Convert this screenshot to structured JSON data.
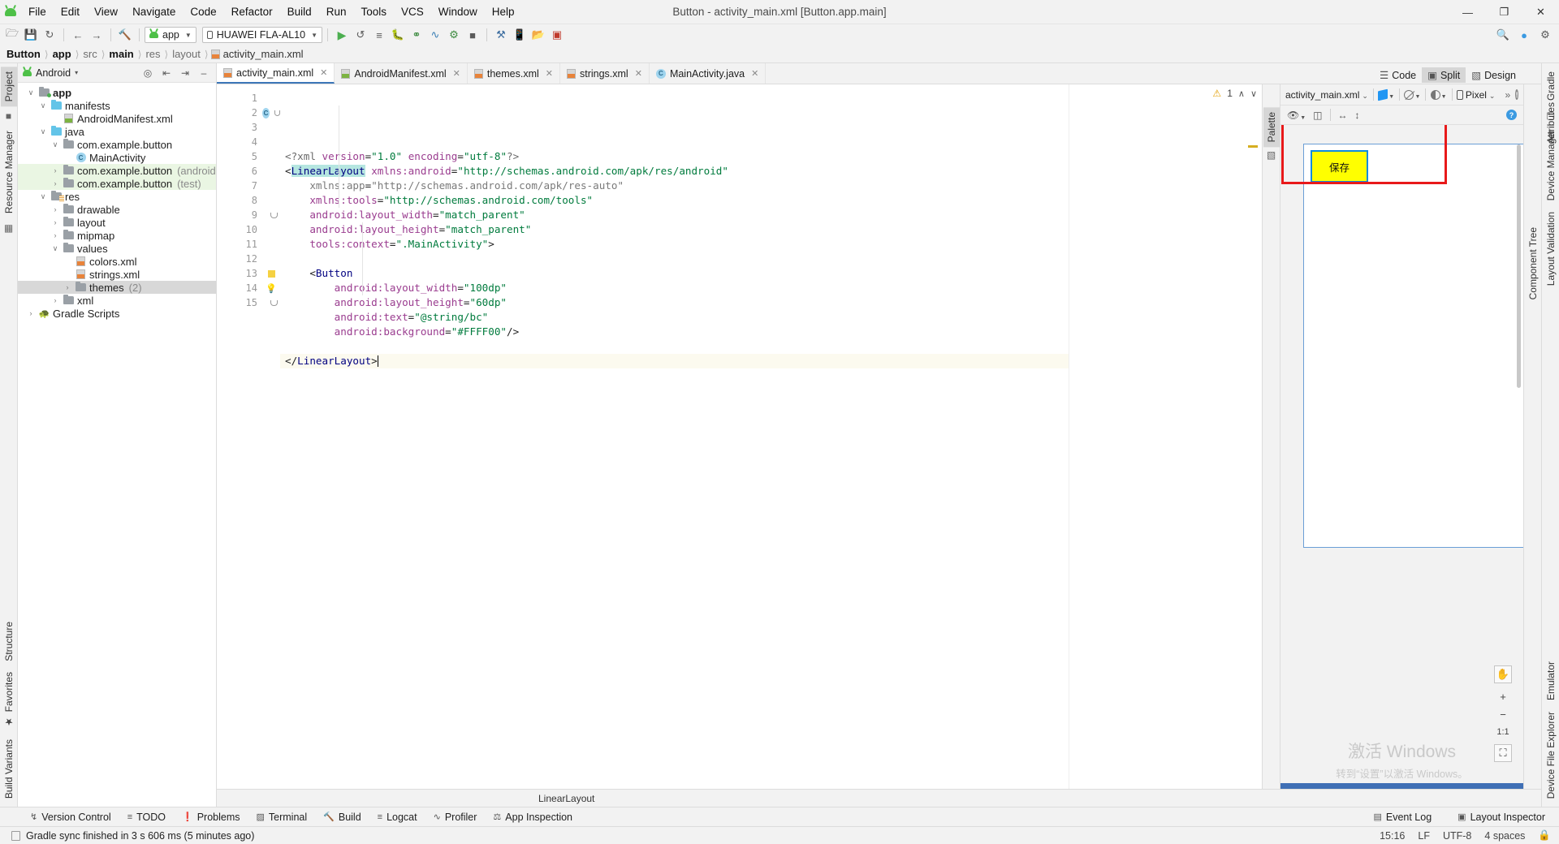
{
  "window": {
    "title": "Button - activity_main.xml [Button.app.main]",
    "minimize": "—",
    "maximize": "❐",
    "close": "✕"
  },
  "menubar": {
    "items": [
      "File",
      "Edit",
      "View",
      "Navigate",
      "Code",
      "Refactor",
      "Build",
      "Run",
      "Tools",
      "VCS",
      "Window",
      "Help"
    ]
  },
  "toolbar": {
    "module_selector": "app",
    "device_selector": "HUAWEI FLA-AL10",
    "icons": [
      "open-folder-icon",
      "save-icon",
      "sync-icon",
      "back-icon",
      "forward-icon",
      "build-hammer-icon",
      "run-icon",
      "run-coverage-icon",
      "run-with-profiler-icon",
      "debug-icon",
      "attach-debugger-icon",
      "profiler-icon",
      "run-device-icon",
      "stop-icon",
      "sdk-manager-icon",
      "avd-manager-icon",
      "device-file-explorer-icon",
      "layout-inspector-icon"
    ],
    "right_icons": [
      "search-icon",
      "account-icon",
      "settings-icon"
    ]
  },
  "breadcrumb": {
    "items": [
      {
        "label": "Button",
        "bold": true
      },
      {
        "label": "app",
        "bold": true
      },
      {
        "label": "src",
        "bold": false
      },
      {
        "label": "main",
        "bold": true
      },
      {
        "label": "res",
        "bold": false
      },
      {
        "label": "layout",
        "bold": false
      }
    ],
    "file": "activity_main.xml"
  },
  "left_rail": {
    "top_tabs": [
      "Project",
      "Resource Manager"
    ],
    "bottom_tabs": [
      "Structure",
      "Favorites",
      "Build Variants"
    ]
  },
  "project_panel": {
    "header": {
      "title": "Android",
      "caret": "▾",
      "icons": [
        "locate-icon",
        "expand-all-icon",
        "collapse-all-icon",
        "hide-icon"
      ]
    },
    "tree": [
      {
        "depth": 0,
        "twist": "∨",
        "icon": "folder-green-dot",
        "label": "app",
        "bold": true,
        "dim": "",
        "hl": ""
      },
      {
        "depth": 1,
        "twist": "∨",
        "icon": "folder-blue",
        "label": "manifests",
        "bold": false,
        "dim": "",
        "hl": ""
      },
      {
        "depth": 2,
        "twist": "",
        "icon": "file-manifest",
        "label": "AndroidManifest.xml",
        "bold": false,
        "dim": "",
        "hl": ""
      },
      {
        "depth": 1,
        "twist": "∨",
        "icon": "folder-blue",
        "label": "java",
        "bold": false,
        "dim": "",
        "hl": ""
      },
      {
        "depth": 2,
        "twist": "∨",
        "icon": "folder-pkg",
        "label": "com.example.button",
        "bold": false,
        "dim": "",
        "hl": ""
      },
      {
        "depth": 3,
        "twist": "",
        "icon": "class-icon",
        "label": "MainActivity",
        "bold": false,
        "dim": "",
        "hl": ""
      },
      {
        "depth": 2,
        "twist": "›",
        "icon": "folder-pkg",
        "label": "com.example.button",
        "bold": false,
        "dim": "(androidTest)",
        "hl": "green"
      },
      {
        "depth": 2,
        "twist": "›",
        "icon": "folder-pkg",
        "label": "com.example.button",
        "bold": false,
        "dim": "(test)",
        "hl": "green"
      },
      {
        "depth": 1,
        "twist": "∨",
        "icon": "folder-res",
        "label": "res",
        "bold": false,
        "dim": "",
        "hl": ""
      },
      {
        "depth": 2,
        "twist": "›",
        "icon": "folder-pkg",
        "label": "drawable",
        "bold": false,
        "dim": "",
        "hl": ""
      },
      {
        "depth": 2,
        "twist": "›",
        "icon": "folder-pkg",
        "label": "layout",
        "bold": false,
        "dim": "",
        "hl": ""
      },
      {
        "depth": 2,
        "twist": "›",
        "icon": "folder-pkg",
        "label": "mipmap",
        "bold": false,
        "dim": "",
        "hl": ""
      },
      {
        "depth": 2,
        "twist": "∨",
        "icon": "folder-pkg",
        "label": "values",
        "bold": false,
        "dim": "",
        "hl": ""
      },
      {
        "depth": 3,
        "twist": "",
        "icon": "file-xml",
        "label": "colors.xml",
        "bold": false,
        "dim": "",
        "hl": ""
      },
      {
        "depth": 3,
        "twist": "",
        "icon": "file-xml",
        "label": "strings.xml",
        "bold": false,
        "dim": "",
        "hl": ""
      },
      {
        "depth": 3,
        "twist": "›",
        "icon": "folder-pkg",
        "label": "themes",
        "bold": false,
        "dim": "(2)",
        "hl": "grey"
      },
      {
        "depth": 2,
        "twist": "›",
        "icon": "folder-pkg",
        "label": "xml",
        "bold": false,
        "dim": "",
        "hl": ""
      },
      {
        "depth": 0,
        "twist": "›",
        "icon": "gradle-icon",
        "label": "Gradle Scripts",
        "bold": false,
        "dim": "",
        "hl": ""
      }
    ]
  },
  "editor_tabs": [
    {
      "label": "activity_main.xml",
      "icon": "xml-file-icon",
      "active": true
    },
    {
      "label": "AndroidManifest.xml",
      "icon": "manifest-file-icon",
      "active": false
    },
    {
      "label": "themes.xml",
      "icon": "xml-file-icon",
      "active": false
    },
    {
      "label": "strings.xml",
      "icon": "xml-file-icon",
      "active": false
    },
    {
      "label": "MainActivity.java",
      "icon": "java-class-icon",
      "active": false
    }
  ],
  "code": {
    "lines": [
      {
        "n": 1,
        "current": false,
        "tokens": [
          {
            "t": "<?xml ",
            "c": "tk-pi"
          },
          {
            "t": "version",
            "c": "tk-attr"
          },
          {
            "t": "=",
            "c": "tk-punc"
          },
          {
            "t": "\"1.0\"",
            "c": "tk-val"
          },
          {
            "t": " ",
            "c": "tk-punc"
          },
          {
            "t": "encoding",
            "c": "tk-attr"
          },
          {
            "t": "=",
            "c": "tk-punc"
          },
          {
            "t": "\"utf-8\"",
            "c": "tk-val"
          },
          {
            "t": "?>",
            "c": "tk-pi"
          }
        ]
      },
      {
        "n": 2,
        "current": false,
        "tokens": [
          {
            "t": "<",
            "c": "tk-punc"
          },
          {
            "t": "LinearLayout",
            "c": "tk-tag-hl"
          },
          {
            "t": " ",
            "c": "tk-punc"
          },
          {
            "t": "xmlns:android",
            "c": "tk-attr"
          },
          {
            "t": "=",
            "c": "tk-punc"
          },
          {
            "t": "\"http://schemas.android.com/apk/res/android\"",
            "c": "tk-val"
          }
        ]
      },
      {
        "n": 3,
        "current": false,
        "tokens": [
          {
            "t": "    ",
            "c": "tk-punc"
          },
          {
            "t": "xmlns:app",
            "c": "tk-grey"
          },
          {
            "t": "=",
            "c": "tk-punc"
          },
          {
            "t": "\"http://schemas.android.com/apk/res-auto\"",
            "c": "tk-grey"
          }
        ]
      },
      {
        "n": 4,
        "current": false,
        "tokens": [
          {
            "t": "    ",
            "c": "tk-punc"
          },
          {
            "t": "xmlns:tools",
            "c": "tk-attr"
          },
          {
            "t": "=",
            "c": "tk-punc"
          },
          {
            "t": "\"http://schemas.android.com/tools\"",
            "c": "tk-val"
          }
        ]
      },
      {
        "n": 5,
        "current": false,
        "tokens": [
          {
            "t": "    ",
            "c": "tk-punc"
          },
          {
            "t": "android:layout_width",
            "c": "tk-attr"
          },
          {
            "t": "=",
            "c": "tk-punc"
          },
          {
            "t": "\"match_parent\"",
            "c": "tk-val"
          }
        ]
      },
      {
        "n": 6,
        "current": false,
        "tokens": [
          {
            "t": "    ",
            "c": "tk-punc"
          },
          {
            "t": "android:layout_height",
            "c": "tk-attr"
          },
          {
            "t": "=",
            "c": "tk-punc"
          },
          {
            "t": "\"match_parent\"",
            "c": "tk-val"
          }
        ]
      },
      {
        "n": 7,
        "current": false,
        "tokens": [
          {
            "t": "    ",
            "c": "tk-punc"
          },
          {
            "t": "tools:context",
            "c": "tk-attr"
          },
          {
            "t": "=",
            "c": "tk-punc"
          },
          {
            "t": "\".MainActivity\"",
            "c": "tk-val"
          },
          {
            "t": ">",
            "c": "tk-punc"
          }
        ]
      },
      {
        "n": 8,
        "current": false,
        "tokens": []
      },
      {
        "n": 9,
        "current": false,
        "tokens": [
          {
            "t": "    <",
            "c": "tk-punc"
          },
          {
            "t": "Button",
            "c": "tk-tag"
          }
        ]
      },
      {
        "n": 10,
        "current": false,
        "tokens": [
          {
            "t": "        ",
            "c": "tk-punc"
          },
          {
            "t": "android:layout_width",
            "c": "tk-attr"
          },
          {
            "t": "=",
            "c": "tk-punc"
          },
          {
            "t": "\"100dp\"",
            "c": "tk-val"
          }
        ]
      },
      {
        "n": 11,
        "current": false,
        "tokens": [
          {
            "t": "        ",
            "c": "tk-punc"
          },
          {
            "t": "android:layout_height",
            "c": "tk-attr"
          },
          {
            "t": "=",
            "c": "tk-punc"
          },
          {
            "t": "\"60dp\"",
            "c": "tk-val"
          }
        ]
      },
      {
        "n": 12,
        "current": false,
        "tokens": [
          {
            "t": "        ",
            "c": "tk-punc"
          },
          {
            "t": "android:text",
            "c": "tk-attr"
          },
          {
            "t": "=",
            "c": "tk-punc"
          },
          {
            "t": "\"@string/bc\"",
            "c": "tk-val"
          }
        ]
      },
      {
        "n": 13,
        "current": false,
        "tokens": [
          {
            "t": "        ",
            "c": "tk-punc"
          },
          {
            "t": "android:background",
            "c": "tk-attr"
          },
          {
            "t": "=",
            "c": "tk-punc"
          },
          {
            "t": "\"#FFFF00\"",
            "c": "tk-val"
          },
          {
            "t": "/>",
            "c": "tk-punc"
          }
        ]
      },
      {
        "n": 14,
        "current": false,
        "tokens": []
      },
      {
        "n": 15,
        "current": true,
        "tokens": [
          {
            "t": "</",
            "c": "tk-punc"
          },
          {
            "t": "LinearLayout",
            "c": "tk-tag"
          },
          {
            "t": ">",
            "c": "tk-punc"
          }
        ]
      }
    ],
    "gutter_marks": {
      "line2": "class-marker",
      "line13": "warning-square",
      "line14": "intention-bulb"
    }
  },
  "inspections": {
    "warning_count": "1",
    "up_arrow": "∧",
    "down_arrow": "∨",
    "warning_icon": "warning-triangle-icon"
  },
  "design": {
    "view_modes": [
      {
        "label": "Code",
        "active": false,
        "icon": "code-view-icon"
      },
      {
        "label": "Split",
        "active": true,
        "icon": "split-view-icon"
      },
      {
        "label": "Design",
        "active": false,
        "icon": "design-view-icon"
      }
    ],
    "file_selector": "activity_main.xml",
    "device_selector": "Pixel",
    "overflow": "»",
    "palette_tab": "Palette",
    "component_tree_tab": "Component Tree",
    "attributes_tab": "Attributes",
    "preview_button_text": "保存",
    "preview_button_bg": "#FFFF00",
    "selection_color": "#0F8BDC",
    "annotation_color": "#E8191A",
    "zoom_reset_label": "1:1",
    "zoom_in": "+",
    "zoom_out": "−",
    "watermark_title": "激活 Windows",
    "watermark_subtitle": "转到“设置”以激活 Windows。"
  },
  "right_rail": {
    "tabs": [
      "Gradle",
      "Device Manager",
      "Layout Validation",
      "Emulator",
      "Device File Explorer"
    ]
  },
  "editor_status": {
    "element": "LinearLayout"
  },
  "bottom_tools": {
    "items": [
      {
        "label": "Version Control",
        "icon": "branch-icon"
      },
      {
        "label": "TODO",
        "icon": "list-icon"
      },
      {
        "label": "Problems",
        "icon": "error-icon"
      },
      {
        "label": "Terminal",
        "icon": "terminal-icon"
      },
      {
        "label": "Build",
        "icon": "hammer-icon"
      },
      {
        "label": "Logcat",
        "icon": "logcat-icon"
      },
      {
        "label": "Profiler",
        "icon": "profiler-icon"
      },
      {
        "label": "App Inspection",
        "icon": "inspection-icon"
      }
    ],
    "right_items": [
      {
        "label": "Event Log",
        "icon": "event-log-icon"
      },
      {
        "label": "Layout Inspector",
        "icon": "layout-inspector-icon"
      }
    ]
  },
  "statusbar": {
    "message": "Gradle sync finished in 3 s 606 ms (5 minutes ago)",
    "time": "15:16",
    "line_separator": "LF",
    "encoding": "UTF-8",
    "indent": "4 spaces",
    "lock_icon": "lock-icon"
  }
}
